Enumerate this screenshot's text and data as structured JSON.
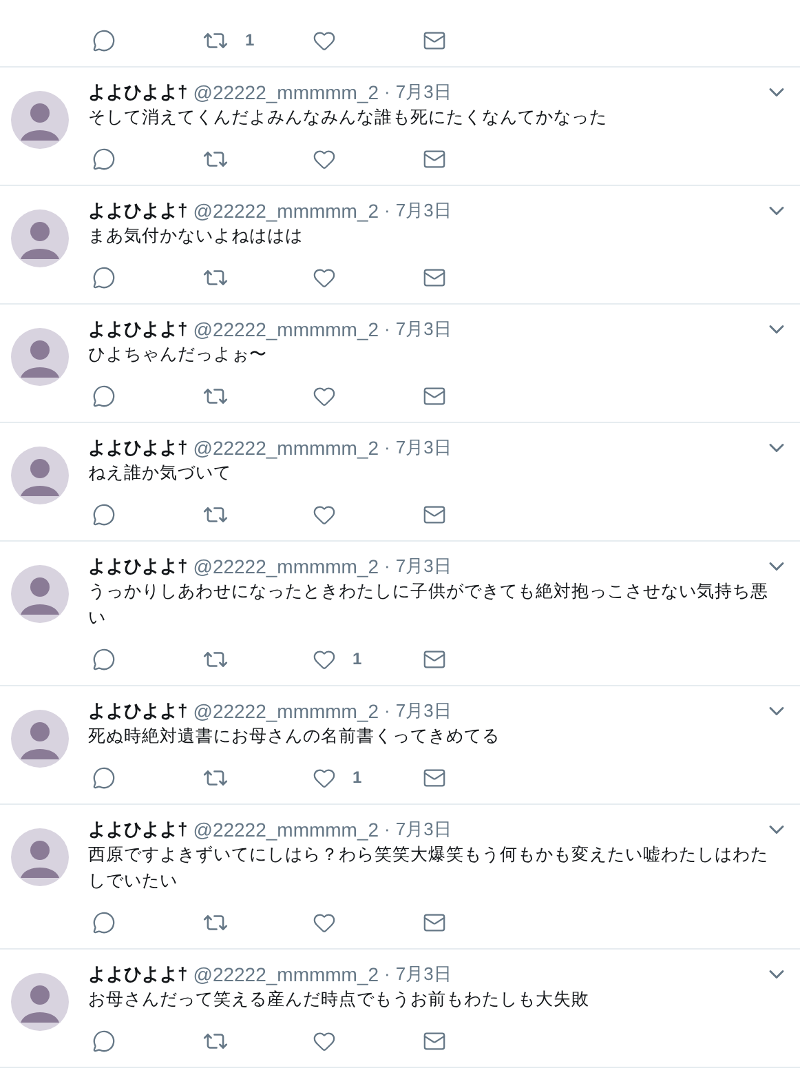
{
  "partial_tweet": {
    "actions": {
      "retweets": "1"
    }
  },
  "tweets": [
    {
      "name": "よよひよよ†",
      "handle": "@22222_mmmmm_2",
      "separator": "·",
      "date": "7月3日",
      "text": "そして消えてくんだよみんなみんな誰も死にたくなんてかなった"
    },
    {
      "name": "よよひよよ†",
      "handle": "@22222_mmmmm_2",
      "separator": "·",
      "date": "7月3日",
      "text": "まあ気付かないよねははは"
    },
    {
      "name": "よよひよよ†",
      "handle": "@22222_mmmmm_2",
      "separator": "·",
      "date": "7月3日",
      "text": "ひよちゃんだっよぉ〜"
    },
    {
      "name": "よよひよよ†",
      "handle": "@22222_mmmmm_2",
      "separator": "·",
      "date": "7月3日",
      "text": "ねえ誰か気づいて"
    },
    {
      "name": "よよひよよ†",
      "handle": "@22222_mmmmm_2",
      "separator": "·",
      "date": "7月3日",
      "text": "うっかりしあわせになったときわたしに子供ができても絶対抱っこさせない気持ち悪い",
      "actions": {
        "likes": "1"
      }
    },
    {
      "name": "よよひよよ†",
      "handle": "@22222_mmmmm_2",
      "separator": "·",
      "date": "7月3日",
      "text": "死ぬ時絶対遺書にお母さんの名前書くってきめてる",
      "actions": {
        "likes": "1"
      }
    },
    {
      "name": "よよひよよ†",
      "handle": "@22222_mmmmm_2",
      "separator": "·",
      "date": "7月3日",
      "text": "西原ですよきずいてにしはら？わら笑笑大爆笑もう何もかも変えたい嘘わたしはわたしでいたい"
    },
    {
      "name": "よよひよよ†",
      "handle": "@22222_mmmmm_2",
      "separator": "·",
      "date": "7月3日",
      "text": "お母さんだって笑える産んだ時点でもうお前もわたしも大失敗"
    }
  ]
}
